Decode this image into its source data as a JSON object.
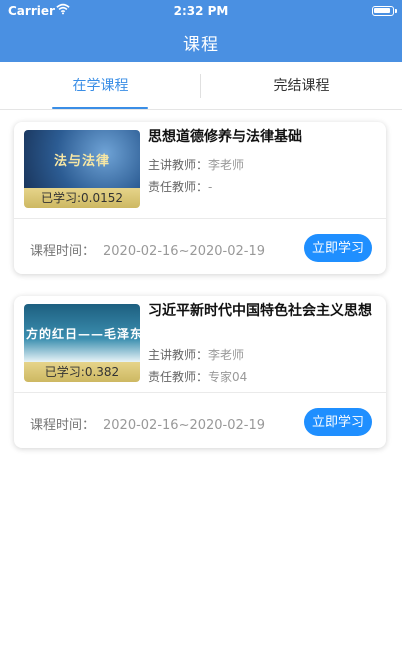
{
  "status_bar": {
    "carrier": "Carrier",
    "time": "2:32 PM"
  },
  "nav": {
    "title": "课程"
  },
  "tabs": [
    {
      "label": "在学课程",
      "active": true
    },
    {
      "label": "完结课程",
      "active": false
    }
  ],
  "colors": {
    "nav_bg": "#4a90e2",
    "accent": "#3a8ee6",
    "button_bg": "#1f8fff"
  },
  "courses": [
    {
      "thumbnail_text": "法与法律",
      "progress_text": "已学习:0.0152",
      "title": "思想道德修养与法律基础",
      "lecturer_label": "主讲教师：",
      "lecturer": "李老师",
      "responsible_label": "责任教师：",
      "responsible": "-",
      "time_label": "课程时间：",
      "time_range": "2020-02-16~2020-02-19",
      "button_label": "立即学习"
    },
    {
      "thumbnail_text": "方的红日——毛泽东思想",
      "progress_text": "已学习:0.382",
      "title": "习近平新时代中国特色社会主义思想",
      "lecturer_label": "主讲教师：",
      "lecturer": "李老师",
      "responsible_label": "责任教师：",
      "responsible": "专家04",
      "time_label": "课程时间：",
      "time_range": "2020-02-16~2020-02-19",
      "button_label": "立即学习"
    }
  ]
}
